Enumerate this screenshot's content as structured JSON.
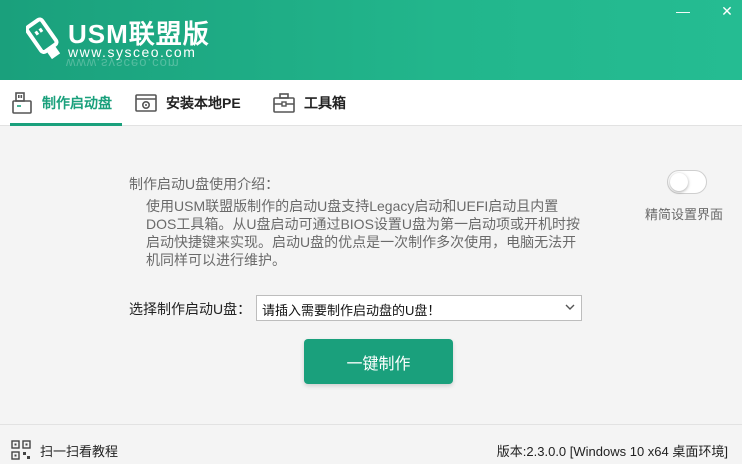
{
  "header": {
    "app_name": "USM联盟版",
    "url": "www.sysceo.com",
    "minimize_glyph": "—",
    "close_glyph": "✕"
  },
  "tabs": [
    {
      "label": "制作启动盘",
      "icon": "usb-drive-icon",
      "active": true
    },
    {
      "label": "安装本地PE",
      "icon": "gear-window-icon",
      "active": false
    },
    {
      "label": "工具箱",
      "icon": "toolbox-icon",
      "active": false
    }
  ],
  "main": {
    "intro_title": "制作启动U盘使用介绍：",
    "intro_text": "使用USM联盟版制作的启动U盘支持Legacy启动和UEFI启动且内置DOS工具箱。从U盘启动可通过BIOS设置U盘为第一启动项或开机时按启动快捷键来实现。启动U盘的优点是一次制作多次使用，电脑无法开机同样可以进行维护。",
    "toggle_label": "精简设置界面",
    "toggle_on": false,
    "select_label": "选择制作启动U盘：",
    "select_value": "请插入需要制作启动盘的U盘！",
    "make_button": "一键制作"
  },
  "footer": {
    "scan_text": "扫一扫看教程",
    "version": "版本:2.3.0.0 [Windows 10 x64 桌面环境]"
  },
  "colors": {
    "brand": "#1aa07c",
    "header_gradient_end": "#25bc92"
  }
}
